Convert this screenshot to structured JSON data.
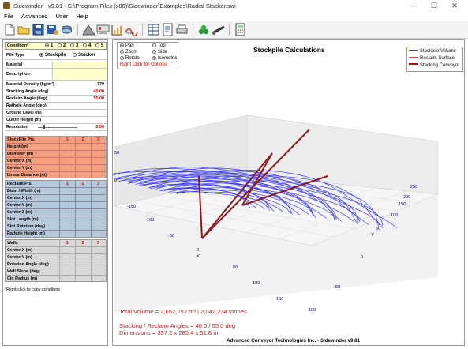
{
  "window": {
    "title": "Sidewinder - v9.81 - C:\\Program Files (x86)\\Sidewinder\\Examples\\Radial Stacker.swi",
    "minimize": "—",
    "maximize": "☐",
    "close": "✕"
  },
  "menu": [
    "File",
    "Advanced",
    "User",
    "Help"
  ],
  "toolbar": {
    "loading_label": "Loading",
    "stress_label": "Stress"
  },
  "left": {
    "condition_label": "Condition*",
    "conditions": [
      "1",
      "2",
      "3",
      "4",
      "5"
    ],
    "pile_type_label": "Pile Type",
    "pile_types": [
      "Stockpile",
      "Stacker"
    ],
    "rows_a": [
      {
        "label": "Material",
        "value": ""
      },
      {
        "label": "Description",
        "value": ""
      }
    ],
    "rows_b": [
      {
        "label": "Material Density (kg/m³)",
        "value": "770"
      },
      {
        "label": "Stacking Angle (deg)",
        "value": "40.00"
      },
      {
        "label": "Reclaim Angle (deg)",
        "value": "55.00"
      },
      {
        "label": "Rathole Angle (deg)",
        "value": ""
      },
      {
        "label": "Ground Level (m)",
        "value": ""
      },
      {
        "label": "Cutoff Height (m)",
        "value": ""
      },
      {
        "label": "Resolution",
        "value": "2.00"
      }
    ],
    "stockpile": {
      "header": "StockPile Pts.",
      "cols": [
        "1",
        "2",
        "3"
      ],
      "rows": [
        "Height (m)",
        "Diameter (m)",
        "Center X (m)",
        "Center Y (m)",
        "Linear Distance (m)"
      ]
    },
    "reclaim": {
      "header": "Reclaim Pts.",
      "cols": [
        "1",
        "2",
        "3"
      ],
      "rows": [
        "Diam / Width (m)",
        "Center X (m)",
        "Center Y (m)",
        "Center Z (m)",
        "Slot Length (m)",
        "Slot Rotation (deg)",
        "Rathole Height (m)"
      ]
    },
    "walls": {
      "header": "Walls",
      "cols": [
        "1",
        "2",
        "3"
      ],
      "rows": [
        "Center X (m)",
        "Center Y (m)",
        "Rotation Angle (deg)",
        "Wall Slope (deg)",
        "Cir. Radius (m)"
      ]
    },
    "footnote": "*Right click to copy conditons"
  },
  "plot": {
    "title": "Stockpile Calculations",
    "view_options": [
      "Pan",
      "Top",
      "Zoom",
      "Side",
      "Rotate",
      "Isometric"
    ],
    "view_selected": [
      "Pan",
      "Isometric"
    ],
    "hint": "Right Click for Options",
    "legend": [
      {
        "name": "Stockpile Volume",
        "color": "#3a3aff"
      },
      {
        "name": "Reclaim Surface",
        "color": "#d04040"
      },
      {
        "name": "Stacking Conveyor",
        "color": "#8b1a1a"
      }
    ],
    "x_ticks": [
      "-150",
      "-100",
      "-50",
      "0",
      "50",
      "100",
      "150"
    ],
    "x_axis_letter": "X",
    "y_ticks": [
      "-100",
      "-50",
      "0",
      "50",
      "100",
      "150",
      "200",
      "250"
    ],
    "y_axis_letter": "Y",
    "z_ticks": [
      "50",
      "0"
    ],
    "summary": {
      "volume": "Total Volume = 2,652,252 m³ | 2,042,234 tonnes",
      "angles": "Stacking / Reclaim Angles = 40.0 / 55.0 deg",
      "dimensions": "Dimensions = 357.2 x 285.4 x 51.8 m"
    },
    "credit": "Advanced Conveyor Technologies Inc. - Sidewinder v9.81"
  },
  "colors": {
    "stockpile_bg": "#f4a07e",
    "reclaim_bg": "#b6c8dc",
    "walls_bg": "#d8d8d8",
    "highlight_bg": "#ffffcc",
    "value_red": "#cc0000",
    "summary_red": "#b22222"
  }
}
